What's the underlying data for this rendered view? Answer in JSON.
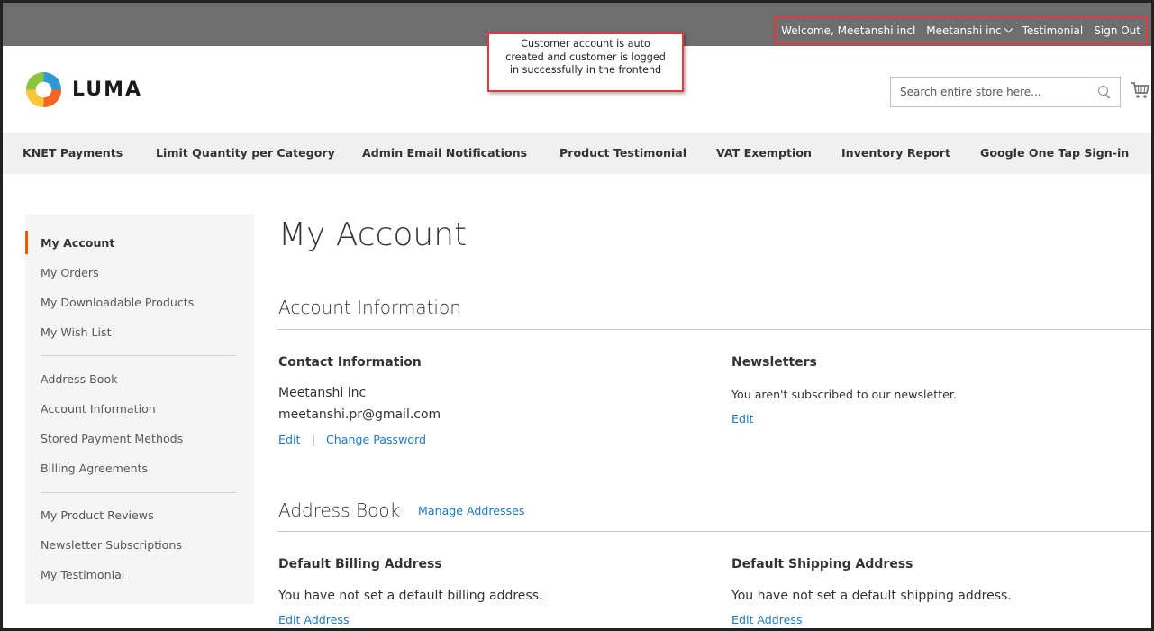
{
  "topbar": {
    "welcome": "Welcome, Meetanshi incl",
    "account": "Meetanshi inc",
    "testimonial": "Testimonial",
    "signout": "Sign Out"
  },
  "callout": {
    "lines": [
      "Customer account is auto",
      "created and customer is logged",
      "in successfully in the frontend"
    ]
  },
  "header": {
    "logo_text": "LUMA",
    "search_placeholder": "Search entire store here...",
    "icons": [
      "search-icon",
      "cart-icon"
    ]
  },
  "nav": {
    "items": [
      "KNET Payments",
      "Limit Quantity per Category",
      "Admin Email Notifications",
      "Product Testimonial",
      "VAT Exemption",
      "Inventory Report",
      "Google One Tap Sign-in"
    ]
  },
  "sidebar": {
    "group1": [
      "My Account",
      "My Orders",
      "My Downloadable Products",
      "My Wish List"
    ],
    "group2": [
      "Address Book",
      "Account Information",
      "Stored Payment Methods",
      "Billing Agreements"
    ],
    "group3": [
      "My Product Reviews",
      "Newsletter Subscriptions",
      "My Testimonial"
    ]
  },
  "main": {
    "page_title": "My Account",
    "account_info": {
      "title": "Account Information",
      "contact": {
        "title": "Contact Information",
        "name": "Meetanshi inc",
        "email": "meetanshi.pr@gmail.com",
        "edit": "Edit",
        "separator": "|",
        "change_password": "Change Password"
      },
      "newsletters": {
        "title": "Newsletters",
        "text": "You aren't subscribed to our newsletter.",
        "edit": "Edit"
      }
    },
    "address_book": {
      "title": "Address Book",
      "manage": "Manage Addresses",
      "billing": {
        "title": "Default Billing Address",
        "text": "You have not set a default billing address.",
        "edit": "Edit Address"
      },
      "shipping": {
        "title": "Default Shipping Address",
        "text": "You have not set a default shipping address.",
        "edit": "Edit Address"
      }
    }
  },
  "colors": {
    "topbar": "#6e6e6e",
    "accent": "#ff5501",
    "link": "#1979c3",
    "annotation": "#e0393e"
  }
}
